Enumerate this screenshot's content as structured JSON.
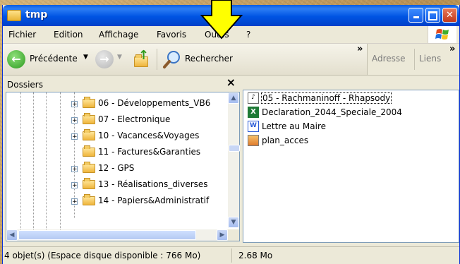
{
  "window": {
    "title": "tmp"
  },
  "menu": {
    "items": [
      "Fichier",
      "Edition",
      "Affichage",
      "Favoris",
      "Outils",
      "?"
    ]
  },
  "toolbar": {
    "back_label": "Précédente",
    "search_label": "Rechercher",
    "overflow_glyph": "»",
    "address_label": "Adresse",
    "links_label": "Liens"
  },
  "folders_pane": {
    "title": "Dossiers",
    "close_glyph": "×",
    "items": [
      {
        "label": "06 - Développements_VB6",
        "expandable": true
      },
      {
        "label": "07 - Electronique",
        "expandable": true
      },
      {
        "label": "10 - Vacances&Voyages",
        "expandable": true
      },
      {
        "label": "11 - Factures&Garanties",
        "expandable": false
      },
      {
        "label": "12 - GPS",
        "expandable": true
      },
      {
        "label": "13 - Réalisations_diverses",
        "expandable": true
      },
      {
        "label": "14 - Papiers&Administratif",
        "expandable": true
      }
    ]
  },
  "files": [
    {
      "label": "05 - Rachmaninoff - Rhapsody",
      "icon": "audio-file-icon",
      "selected": true
    },
    {
      "label": "Declaration_2044_Speciale_2004",
      "icon": "excel-file-icon",
      "selected": false
    },
    {
      "label": "Lettre au Maire",
      "icon": "word-file-icon",
      "selected": false
    },
    {
      "label": "plan_acces",
      "icon": "image-file-icon",
      "selected": false
    }
  ],
  "status": {
    "objects": "4 objet(s) (Espace disque disponible : 766 Mo)",
    "size": "2.68 Mo"
  },
  "colors": {
    "titlebar": "#0054e3",
    "highlight_arrow": "#ffff00",
    "excel_green": "#1e7a36",
    "word_blue": "#2a5bd7"
  }
}
